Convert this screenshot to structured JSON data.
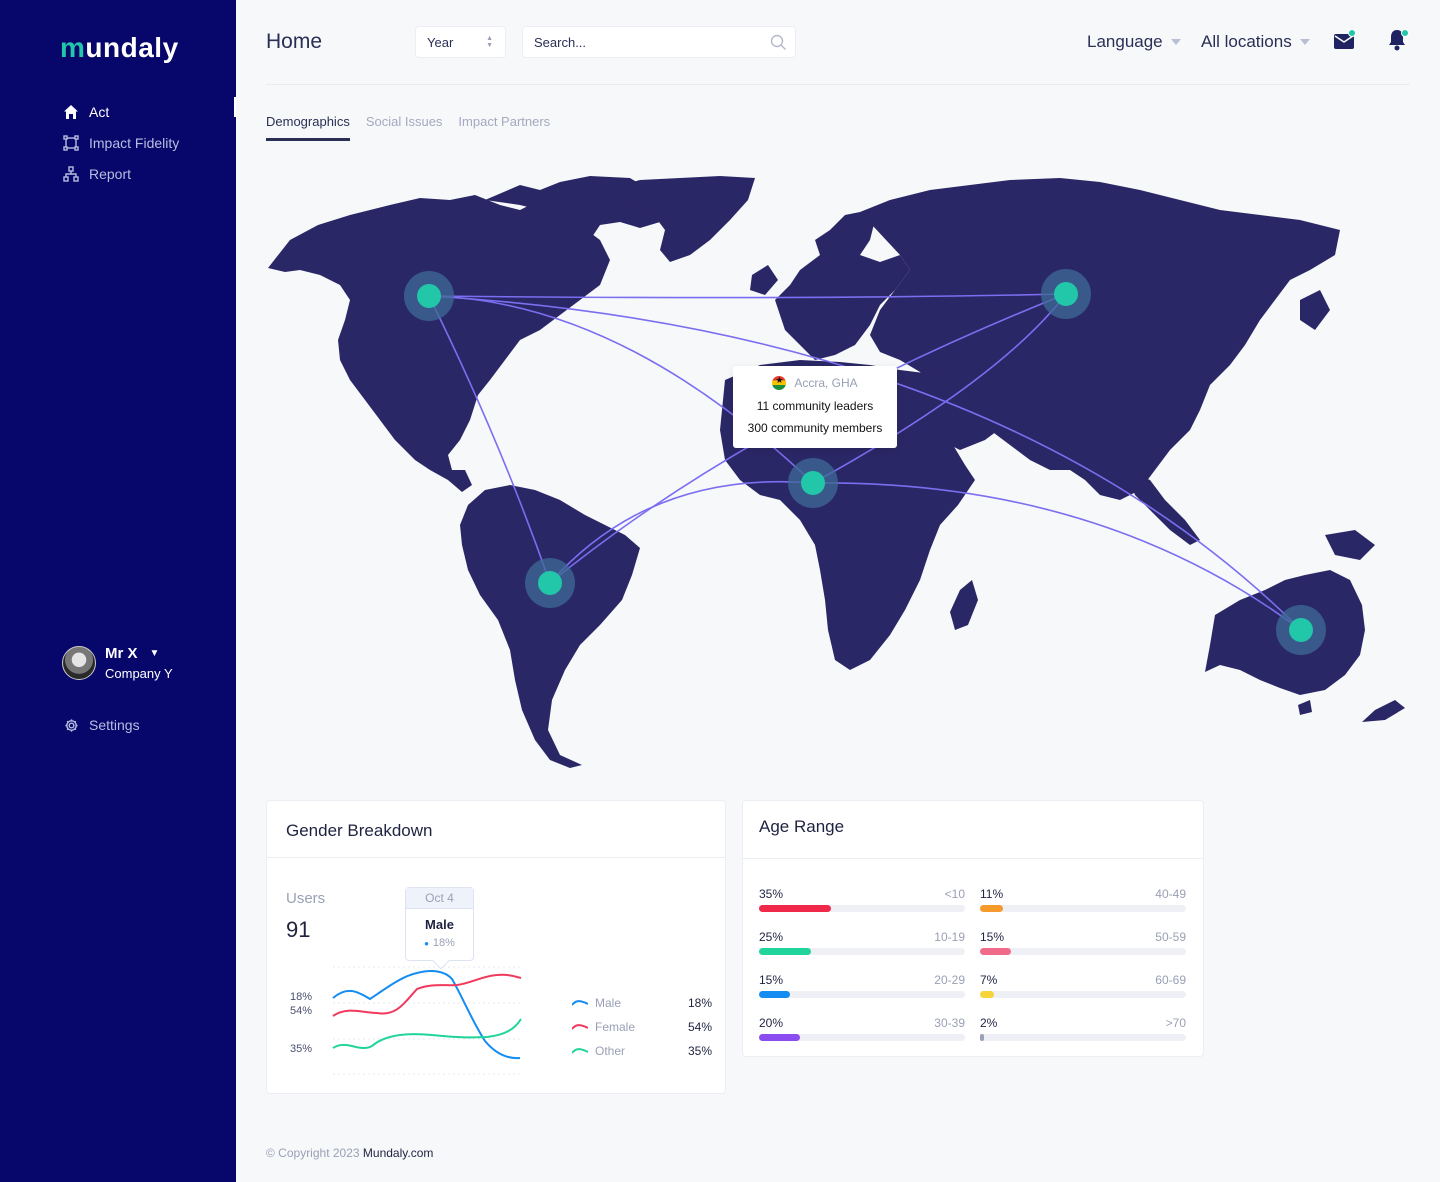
{
  "brand": {
    "logo_prefix": "m",
    "logo_text": "undaly"
  },
  "sidebar": {
    "items": [
      {
        "label": "Act",
        "icon": "home-icon"
      },
      {
        "label": "Impact Fidelity",
        "icon": "frame-icon"
      },
      {
        "label": "Report",
        "icon": "hierarchy-icon"
      }
    ],
    "user": {
      "name": "Mr X",
      "company": "Company Y"
    },
    "settings_label": "Settings"
  },
  "header": {
    "title": "Home",
    "year_select": "Year",
    "search_placeholder": "Search...",
    "language": "Language",
    "locations": "All locations"
  },
  "tabs": [
    "Demographics",
    "Social Issues",
    "Impact Partners"
  ],
  "map": {
    "tooltip": {
      "location": "Accra, GHA",
      "line1": "11 community  leaders",
      "line2": "300 community members"
    },
    "colors": {
      "land": "#2a2766",
      "node": "#21c7a8",
      "link": "#7b6ef0"
    }
  },
  "gender": {
    "title": "Gender Breakdown",
    "users_label": "Users",
    "users_value": "91",
    "tooltip": {
      "date": "Oct 4",
      "name": "Male",
      "pct": "18%"
    },
    "y_labels": [
      "18%",
      "54%",
      "35%"
    ],
    "legend": [
      {
        "name": "Male",
        "pct": "18%",
        "color": "#148cf2"
      },
      {
        "name": "Female",
        "pct": "54%",
        "color": "#f0395d"
      },
      {
        "name": "Other",
        "pct": "35%",
        "color": "#21d49b"
      }
    ]
  },
  "age": {
    "title": "Age Range",
    "items": [
      {
        "pct": "35%",
        "range": "<10",
        "value": 35,
        "color": "#f0284a"
      },
      {
        "pct": "25%",
        "range": "10-19",
        "value": 25,
        "color": "#21d49b"
      },
      {
        "pct": "15%",
        "range": "20-29",
        "value": 15,
        "color": "#148cf2"
      },
      {
        "pct": "20%",
        "range": "30-39",
        "value": 20,
        "color": "#8b4cf0"
      },
      {
        "pct": "11%",
        "range": "40-49",
        "value": 11,
        "color": "#f59a2b"
      },
      {
        "pct": "15%",
        "range": "50-59",
        "value": 15,
        "color": "#f06a8a"
      },
      {
        "pct": "7%",
        "range": "60-69",
        "value": 7,
        "color": "#f5d53a"
      },
      {
        "pct": "2%",
        "range": ">70",
        "value": 2,
        "color": "#9aa0b5"
      }
    ]
  },
  "footer": {
    "copyright": "© Copyright 2023",
    "site": "Mundaly.com"
  }
}
